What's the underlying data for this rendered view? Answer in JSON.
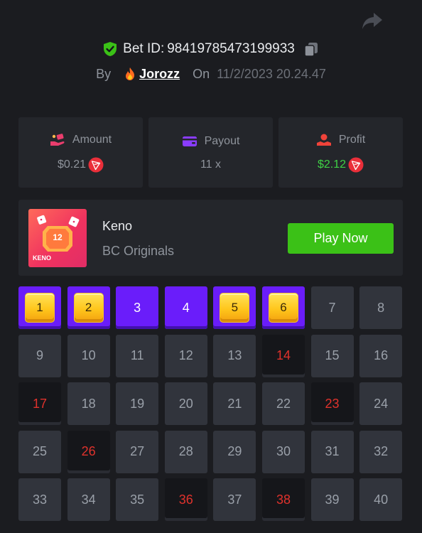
{
  "header": {
    "bet_label": "Bet ID:",
    "bet_id": "98419785473199933",
    "by_label": "By",
    "username": "Jorozz",
    "on_label": "On",
    "datetime": "11/2/2023 20.24.47"
  },
  "stats": [
    {
      "label": "Amount",
      "value": "$0.21",
      "icon": "money-hand-icon"
    },
    {
      "label": "Payout",
      "value": "11 x",
      "icon": "wallet-icon"
    },
    {
      "label": "Profit",
      "value": "$2.12",
      "icon": "profit-user-icon"
    }
  ],
  "game": {
    "title": "Keno",
    "subtitle": "BC Originals",
    "play_label": "Play Now",
    "thumb_text": "KENO",
    "thumb_number": "12"
  },
  "colors": {
    "accent_purple": "#6a1dfa",
    "play_green": "#3bc117",
    "profit_green": "#3fd145",
    "miss_red": "#e0322c",
    "gem_gold": "#ffc61c"
  },
  "board": {
    "cells": [
      {
        "n": "1",
        "s": "hit"
      },
      {
        "n": "2",
        "s": "hit"
      },
      {
        "n": "3",
        "s": "selected"
      },
      {
        "n": "4",
        "s": "selected"
      },
      {
        "n": "5",
        "s": "hit"
      },
      {
        "n": "6",
        "s": "hit"
      },
      {
        "n": "7",
        "s": "normal"
      },
      {
        "n": "8",
        "s": "normal"
      },
      {
        "n": "9",
        "s": "normal"
      },
      {
        "n": "10",
        "s": "normal"
      },
      {
        "n": "11",
        "s": "normal"
      },
      {
        "n": "12",
        "s": "normal"
      },
      {
        "n": "13",
        "s": "normal"
      },
      {
        "n": "14",
        "s": "miss"
      },
      {
        "n": "15",
        "s": "normal"
      },
      {
        "n": "16",
        "s": "normal"
      },
      {
        "n": "17",
        "s": "miss"
      },
      {
        "n": "18",
        "s": "normal"
      },
      {
        "n": "19",
        "s": "normal"
      },
      {
        "n": "20",
        "s": "normal"
      },
      {
        "n": "21",
        "s": "normal"
      },
      {
        "n": "22",
        "s": "normal"
      },
      {
        "n": "23",
        "s": "miss"
      },
      {
        "n": "24",
        "s": "normal"
      },
      {
        "n": "25",
        "s": "normal"
      },
      {
        "n": "26",
        "s": "miss"
      },
      {
        "n": "27",
        "s": "normal"
      },
      {
        "n": "28",
        "s": "normal"
      },
      {
        "n": "29",
        "s": "normal"
      },
      {
        "n": "30",
        "s": "normal"
      },
      {
        "n": "31",
        "s": "normal"
      },
      {
        "n": "32",
        "s": "normal"
      },
      {
        "n": "33",
        "s": "normal"
      },
      {
        "n": "34",
        "s": "normal"
      },
      {
        "n": "35",
        "s": "normal"
      },
      {
        "n": "36",
        "s": "miss"
      },
      {
        "n": "37",
        "s": "normal"
      },
      {
        "n": "38",
        "s": "miss"
      },
      {
        "n": "39",
        "s": "normal"
      },
      {
        "n": "40",
        "s": "normal"
      }
    ]
  }
}
